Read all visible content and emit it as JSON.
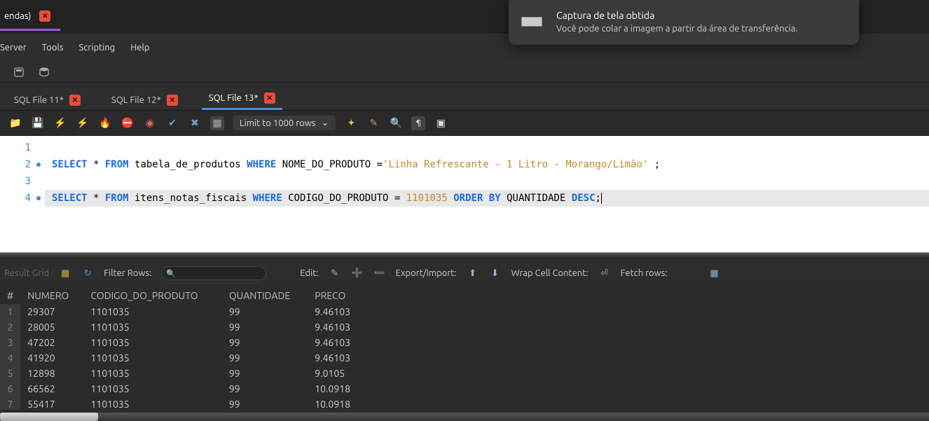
{
  "top_tab": {
    "label": "endas)"
  },
  "menubar": {
    "items": [
      "Server",
      "Tools",
      "Scripting",
      "Help"
    ]
  },
  "file_tabs": [
    {
      "label": "SQL File 11*",
      "active": false
    },
    {
      "label": "SQL File 12*",
      "active": false
    },
    {
      "label": "SQL File 13*",
      "active": true
    }
  ],
  "toolbar": {
    "limit_label": "Limit to 1000 rows"
  },
  "editor": {
    "lines": [
      {
        "n": "1",
        "dot": false
      },
      {
        "n": "2",
        "dot": true
      },
      {
        "n": "3",
        "dot": false
      },
      {
        "n": "4",
        "dot": true
      }
    ],
    "sql1": {
      "select": "SELECT",
      "star": " * ",
      "from": "FROM",
      "tbl": " tabela_de_produtos ",
      "where": "WHERE",
      "col": " NOME_DO_PRODUTO =",
      "str": "'Linha Refrescante - 1 Litro - Morango/Limão'",
      "tail": " ;"
    },
    "sql2": {
      "select": "SELECT",
      "star": " * ",
      "from": "FROM",
      "tbl": " itens_notas_fiscais ",
      "where": "WHERE",
      "col": " CODIGO_DO_PRODUTO = ",
      "num": "1101035",
      "order": " ORDER BY",
      "col2": " QUANTIDADE ",
      "desc": "DESC",
      "semi": ";"
    }
  },
  "results_toolbar": {
    "result_grid": "Result Grid",
    "filter_label": "Filter Rows:",
    "filter_value": "",
    "edit": "Edit:",
    "export": "Export/Import:",
    "wrap": "Wrap Cell Content:",
    "fetch": "Fetch rows:"
  },
  "grid": {
    "headers": [
      "#",
      "NUMERO",
      "CODIGO_DO_PRODUTO",
      "QUANTIDADE",
      "PRECO"
    ],
    "rows": [
      {
        "i": "1",
        "numero": "29307",
        "codigo": "1101035",
        "qt": "99",
        "preco": "9.46103"
      },
      {
        "i": "2",
        "numero": "28005",
        "codigo": "1101035",
        "qt": "99",
        "preco": "9.46103"
      },
      {
        "i": "3",
        "numero": "47202",
        "codigo": "1101035",
        "qt": "99",
        "preco": "9.46103"
      },
      {
        "i": "4",
        "numero": "41920",
        "codigo": "1101035",
        "qt": "99",
        "preco": "9.46103"
      },
      {
        "i": "5",
        "numero": "12898",
        "codigo": "1101035",
        "qt": "99",
        "preco": "9.0105"
      },
      {
        "i": "6",
        "numero": "66562",
        "codigo": "1101035",
        "qt": "99",
        "preco": "10.0918"
      },
      {
        "i": "7",
        "numero": "55417",
        "codigo": "1101035",
        "qt": "99",
        "preco": "10.0918"
      }
    ]
  },
  "toast": {
    "title": "Captura de tela obtida",
    "body": "Você pode colar a imagem a partir da área de transferência."
  }
}
